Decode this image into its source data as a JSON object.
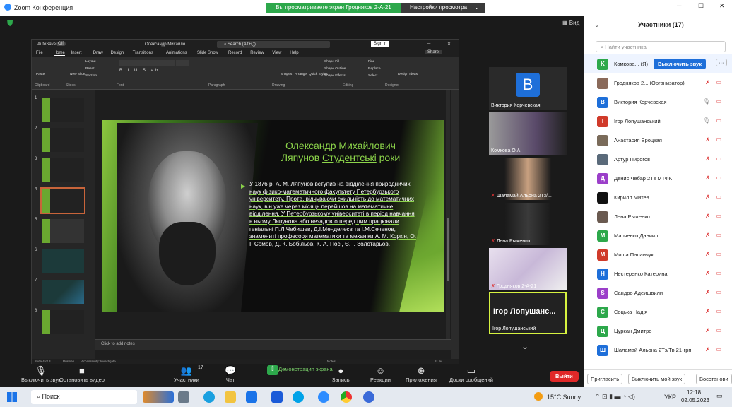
{
  "titlebar": {
    "app": "Zoom Конференция",
    "banner": "Вы просматриваете экран Гродняков 2-А-21",
    "view_options": "Настройки просмотра",
    "view_btn": "Вид"
  },
  "ppt": {
    "autosave": "AutoSave",
    "autosave_state": "Off",
    "doc": "Олександр Михайло...",
    "search": "Search (Alt+Q)",
    "signin": "Sign in",
    "tabs": [
      "File",
      "Home",
      "Insert",
      "Draw",
      "Design",
      "Transitions",
      "Animations",
      "Slide Show",
      "Record",
      "Review",
      "View",
      "Help"
    ],
    "share": "Share",
    "groups": [
      "Clipboard",
      "Slides",
      "Font",
      "Paragraph",
      "Drawing",
      "Editing",
      "Designer"
    ],
    "ribbon_labels": [
      "Paste",
      "New Slide",
      "Layout",
      "Reset",
      "Section",
      "Shapes",
      "Arrange",
      "Quick Styles",
      "Shape Fill",
      "Shape Outline",
      "Shape Effects",
      "Find",
      "Replace",
      "Select",
      "Design Ideas"
    ],
    "slide_numbers": [
      "1",
      "2",
      "3",
      "4",
      "5",
      "6",
      "7",
      "8"
    ],
    "notes": "Click to add notes",
    "status": [
      "Slide 4 of 8",
      "Russian",
      "Accessibility: Investigate"
    ],
    "status_right": [
      "Notes",
      "81 %"
    ]
  },
  "slide": {
    "title_line1": "Олександр Михайлович",
    "title_line2": "Ляпунов ",
    "title_line2b": "Студентські",
    "title_line2c": " роки",
    "body": "У 1876 р. А. М. Ляпунов вступив на відділення природничих наук фізико-математичного факультету Петербурзького університету. Проте, відчуваючи схильність до математичних наук, він уже через місяць перейшов на математичне відділення. У Петербурзькому університеті в період навчання в ньому Ляпунова або незадовго перед цим працювали геніальні П.Л.Чебишев, Д.І.Менделєєв та І.М.Сеченов, знамениті професори математики та механіки А. М. Коркін, О. І. Сомов, Д. К. Бобільов, К. А. Посі, Є. І. Золотарьов."
  },
  "tiles": [
    {
      "name": "Виктория Корчевская",
      "initial": "B"
    },
    {
      "name": "Комкова О.А."
    },
    {
      "name": "Шаламай Альона 2Тз/..."
    },
    {
      "name": "Лена Рыженко"
    },
    {
      "name": "Гродняков 2-А-21"
    },
    {
      "name": "Ігор Лопушанський",
      "big": "Ігор Лопушанс..."
    }
  ],
  "panel": {
    "title": "Участники (17)",
    "search": "Найти участника",
    "unmute_all": "Выключить звук",
    "invite": "Пригласить",
    "mute_me": "Выключить мой звук",
    "restore": "Восстанови",
    "participants": [
      {
        "name": "Комкова... (Я)",
        "initial": "K",
        "color": "#2da84b"
      },
      {
        "name": "Гродняков 2... (Организатор)",
        "initial": "",
        "color": "#8a6a5a"
      },
      {
        "name": "Виктория Корчевская",
        "initial": "B",
        "color": "#1e6fd9"
      },
      {
        "name": "Ігор Лопушанський",
        "initial": "I",
        "color": "#d03a2a"
      },
      {
        "name": "Анастасия Броцкая",
        "initial": "",
        "color": "#7a6b5a"
      },
      {
        "name": "Артур Пирогов",
        "initial": "",
        "color": "#5a6a7a"
      },
      {
        "name": "Денис Чебар 2Тз МТФК",
        "initial": "Д",
        "color": "#9b3fc9"
      },
      {
        "name": "Кирилл Митев",
        "initial": "",
        "color": "#111111"
      },
      {
        "name": "Лена Рыженко",
        "initial": "",
        "color": "#6a5a50"
      },
      {
        "name": "Марченко Даниил",
        "initial": "M",
        "color": "#2da84b"
      },
      {
        "name": "Миша Паланчук",
        "initial": "M",
        "color": "#d03a2a"
      },
      {
        "name": "Нестеренко Катерина",
        "initial": "H",
        "color": "#1e6fd9"
      },
      {
        "name": "Сандро Адеишвили",
        "initial": "S",
        "color": "#9b3fc9"
      },
      {
        "name": "Соцька Надія",
        "initial": "C",
        "color": "#2da84b"
      },
      {
        "name": "Цуркан Дмитро",
        "initial": "Ц",
        "color": "#2da84b"
      },
      {
        "name": "Шаламай Альона 2Тз/Тв 21-грп",
        "initial": "Ш",
        "color": "#1e6fd9"
      }
    ]
  },
  "toolbar": {
    "items": [
      "Выключить звук",
      "Остановить видео",
      "Участники",
      "Чат",
      "Демонстрация экрана",
      "Запись",
      "Реакции",
      "Приложения",
      "Доски сообщений"
    ],
    "participants_count": "17",
    "leave": "Выйти"
  },
  "taskbar": {
    "search": "Поиск",
    "weather": "15°C Sunny",
    "lang": "УКР",
    "time": "12:18",
    "date": "02.05.2023"
  }
}
